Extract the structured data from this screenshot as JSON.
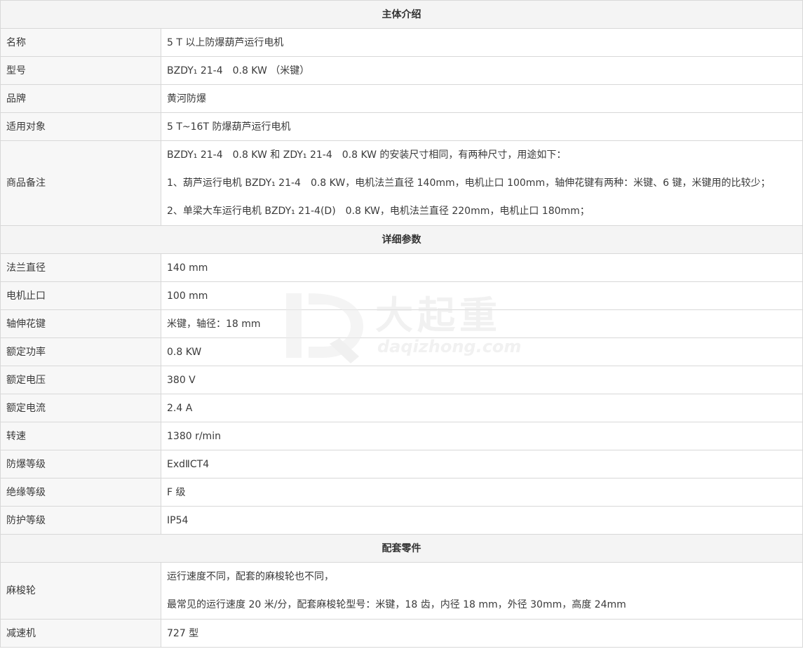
{
  "sections": {
    "intro": "主体介绍",
    "params": "详细参数",
    "parts": "配套零件"
  },
  "intro_rows": [
    {
      "label": "名称",
      "value": "5 T 以上防爆葫芦运行电机"
    },
    {
      "label": "型号",
      "value": "BZDY₁ 21-4　0.8 KW （米键）"
    },
    {
      "label": "品牌",
      "value": "黄河防爆"
    },
    {
      "label": "适用对象",
      "value": "5 T~16T 防爆葫芦运行电机"
    }
  ],
  "remark": {
    "label": "商品备注",
    "lines": [
      "BZDY₁ 21-4　0.8 KW 和 ZDY₁ 21-4　0.8 KW 的安装尺寸相同，有两种尺寸，用途如下：",
      "1、葫芦运行电机 BZDY₁ 21-4　0.8 KW，电机法兰直径 140mm，电机止口 100mm，轴伸花键有两种：米键、6 键，米键用的比较少；",
      "2、单梁大车运行电机 BZDY₁ 21-4(D)　0.8 KW，电机法兰直径 220mm，电机止口 180mm；"
    ]
  },
  "param_rows": [
    {
      "label": "法兰直径",
      "value": "140 mm"
    },
    {
      "label": "电机止口",
      "value": "100 mm"
    },
    {
      "label": "轴伸花键",
      "value": "米键，轴径：18 mm"
    },
    {
      "label": "额定功率",
      "value": "0.8 KW"
    },
    {
      "label": "额定电压",
      "value": "380 V"
    },
    {
      "label": "额定电流",
      "value": "2.4 A"
    },
    {
      "label": "转速",
      "value": "1380 r/min"
    },
    {
      "label": "防爆等级",
      "value": "ExdⅡCT4"
    },
    {
      "label": "绝缘等级",
      "value": "F 级"
    },
    {
      "label": "防护等级",
      "value": "IP54"
    }
  ],
  "wheel": {
    "label": "麻梭轮",
    "lines": [
      "运行速度不同，配套的麻梭轮也不同，",
      "最常见的运行速度 20 米/分，配套麻梭轮型号：米键，18 齿，内径 18 mm，外径 30mm，高度 24mm"
    ]
  },
  "reducer": {
    "label": "减速机",
    "value": "727 型"
  },
  "watermark": {
    "cn": "大起重",
    "en": "daqizhong.com"
  }
}
